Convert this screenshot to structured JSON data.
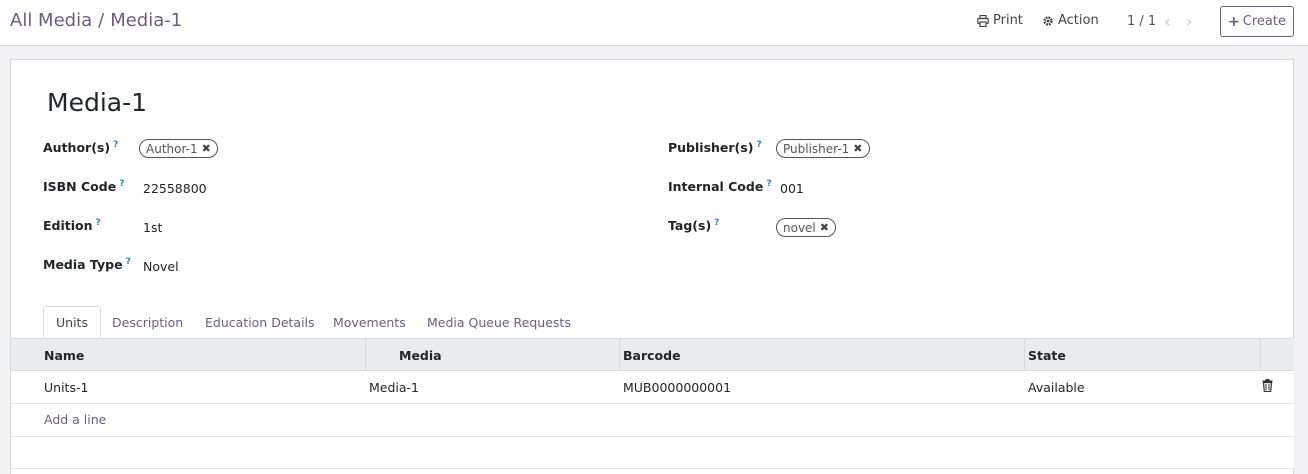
{
  "breadcrumb": {
    "parent": "All Media",
    "separator": "/",
    "current": "Media-1"
  },
  "control_panel": {
    "print_label": "Print",
    "action_label": "Action",
    "pager": "1 / 1",
    "prev_glyph": "‹",
    "next_glyph": "›",
    "create_label": "Create"
  },
  "record": {
    "title": "Media-1",
    "help_glyph": "?",
    "fields": {
      "authors": {
        "label": "Author(s)",
        "tags": [
          "Author-1"
        ]
      },
      "isbn": {
        "label": "ISBN Code",
        "value": "22558800"
      },
      "edition": {
        "label": "Edition",
        "value": "1st"
      },
      "media_type": {
        "label": "Media Type",
        "value": "Novel"
      },
      "publishers": {
        "label": "Publisher(s)",
        "tags": [
          "Publisher-1"
        ]
      },
      "internal_code": {
        "label": "Internal Code",
        "value": "001"
      },
      "tags": {
        "label": "Tag(s)",
        "tags": [
          "novel"
        ]
      }
    }
  },
  "tabs": [
    {
      "label": "Units",
      "active": true
    },
    {
      "label": "Description",
      "active": false
    },
    {
      "label": "Education Details",
      "active": false
    },
    {
      "label": "Movements",
      "active": false
    },
    {
      "label": "Media Queue Requests",
      "active": false
    }
  ],
  "table": {
    "columns": [
      "Name",
      "Media",
      "Barcode",
      "State"
    ],
    "rows": [
      {
        "name": "Units-1",
        "media": "Media-1",
        "barcode": "MUB0000000001",
        "state": "Available"
      }
    ],
    "add_line_label": "Add a line"
  },
  "colors": {
    "accent": "#6f5b88",
    "help": "#1f8ab8",
    "header_bg": "#e9ecef"
  }
}
